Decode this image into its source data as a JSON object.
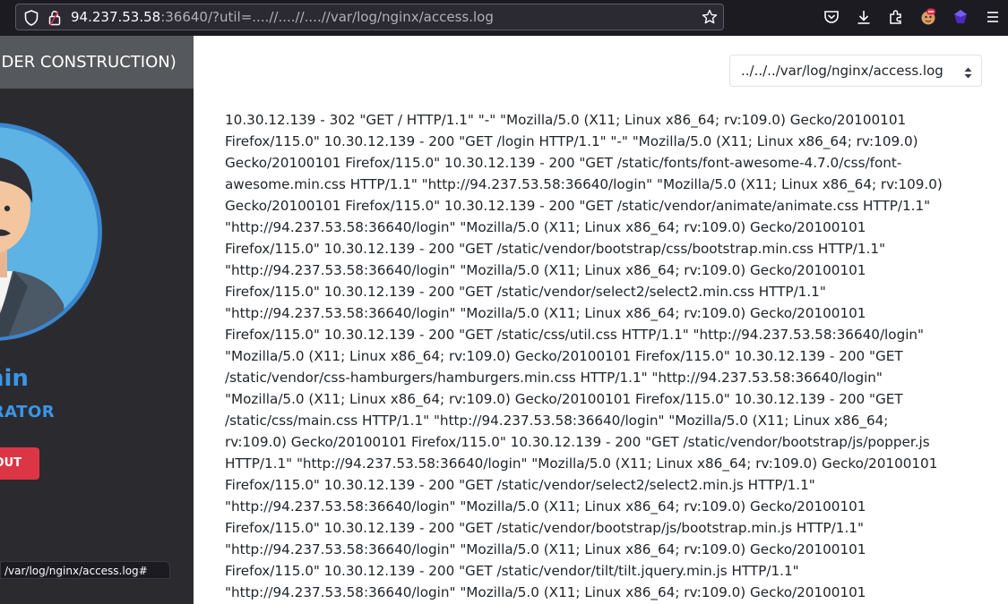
{
  "browser": {
    "url_host": "94.237.53.58",
    "url_rest": ":36640/?util=....//....//....//var/log/nginx/access.log"
  },
  "sidebar": {
    "header": "NDER CONSTRUCTION)",
    "name": "nin",
    "role": "TRATOR",
    "logout_label": "OUT"
  },
  "status_tip": "/var/log/nginx/access.log#",
  "main": {
    "select_value": "../../../var/log/nginx/access.log",
    "log_lines": [
      "10.30.12.139 - 302 \"GET / HTTP/1.1\" \"-\" \"Mozilla/5.0 (X11; Linux x86_64; rv:109.0) Gecko/20100101",
      "Firefox/115.0\" 10.30.12.139 - 200 \"GET /login HTTP/1.1\" \"-\" \"Mozilla/5.0 (X11; Linux x86_64; rv:109.0)",
      "Gecko/20100101 Firefox/115.0\" 10.30.12.139 - 200 \"GET /static/fonts/font-awesome-4.7.0/css/font-",
      "awesome.min.css HTTP/1.1\" \"http://94.237.53.58:36640/login\" \"Mozilla/5.0 (X11; Linux x86_64; rv:109.0)",
      "Gecko/20100101 Firefox/115.0\" 10.30.12.139 - 200 \"GET /static/vendor/animate/animate.css HTTP/1.1\"",
      "\"http://94.237.53.58:36640/login\" \"Mozilla/5.0 (X11; Linux x86_64; rv:109.0) Gecko/20100101",
      "Firefox/115.0\" 10.30.12.139 - 200 \"GET /static/vendor/bootstrap/css/bootstrap.min.css HTTP/1.1\"",
      "\"http://94.237.53.58:36640/login\" \"Mozilla/5.0 (X11; Linux x86_64; rv:109.0) Gecko/20100101",
      "Firefox/115.0\" 10.30.12.139 - 200 \"GET /static/vendor/select2/select2.min.css HTTP/1.1\"",
      "\"http://94.237.53.58:36640/login\" \"Mozilla/5.0 (X11; Linux x86_64; rv:109.0) Gecko/20100101",
      "Firefox/115.0\" 10.30.12.139 - 200 \"GET /static/css/util.css HTTP/1.1\" \"http://94.237.53.58:36640/login\"",
      "\"Mozilla/5.0 (X11; Linux x86_64; rv:109.0) Gecko/20100101 Firefox/115.0\" 10.30.12.139 - 200 \"GET",
      "/static/vendor/css-hamburgers/hamburgers.min.css HTTP/1.1\" \"http://94.237.53.58:36640/login\"",
      "\"Mozilla/5.0 (X11; Linux x86_64; rv:109.0) Gecko/20100101 Firefox/115.0\" 10.30.12.139 - 200 \"GET",
      "/static/css/main.css HTTP/1.1\" \"http://94.237.53.58:36640/login\" \"Mozilla/5.0 (X11; Linux x86_64;",
      "rv:109.0) Gecko/20100101 Firefox/115.0\" 10.30.12.139 - 200 \"GET /static/vendor/bootstrap/js/popper.js",
      "HTTP/1.1\" \"http://94.237.53.58:36640/login\" \"Mozilla/5.0 (X11; Linux x86_64; rv:109.0) Gecko/20100101",
      "Firefox/115.0\" 10.30.12.139 - 200 \"GET /static/vendor/select2/select2.min.js HTTP/1.1\"",
      "\"http://94.237.53.58:36640/login\" \"Mozilla/5.0 (X11; Linux x86_64; rv:109.0) Gecko/20100101",
      "Firefox/115.0\" 10.30.12.139 - 200 \"GET /static/vendor/bootstrap/js/bootstrap.min.js HTTP/1.1\"",
      "\"http://94.237.53.58:36640/login\" \"Mozilla/5.0 (X11; Linux x86_64; rv:109.0) Gecko/20100101",
      "Firefox/115.0\" 10.30.12.139 - 200 \"GET /static/vendor/tilt/tilt.jquery.min.js HTTP/1.1\"",
      "\"http://94.237.53.58:36640/login\" \"Mozilla/5.0 (X11; Linux x86_64; rv:109.0) Gecko/20100101"
    ]
  },
  "colors": {
    "accent": "#3a96e8",
    "logout": "#dc3545",
    "sidebar_bg": "#2b2b2f",
    "chrome_bg": "#1c1b22"
  },
  "icons": {
    "urlbar": [
      "shield-icon",
      "lock-icon",
      "star-icon"
    ],
    "toolbar": [
      "pocket-icon",
      "download-icon",
      "extensions-icon",
      "fox-avatar-icon",
      "purple-ext-icon",
      "menu-icon"
    ]
  }
}
